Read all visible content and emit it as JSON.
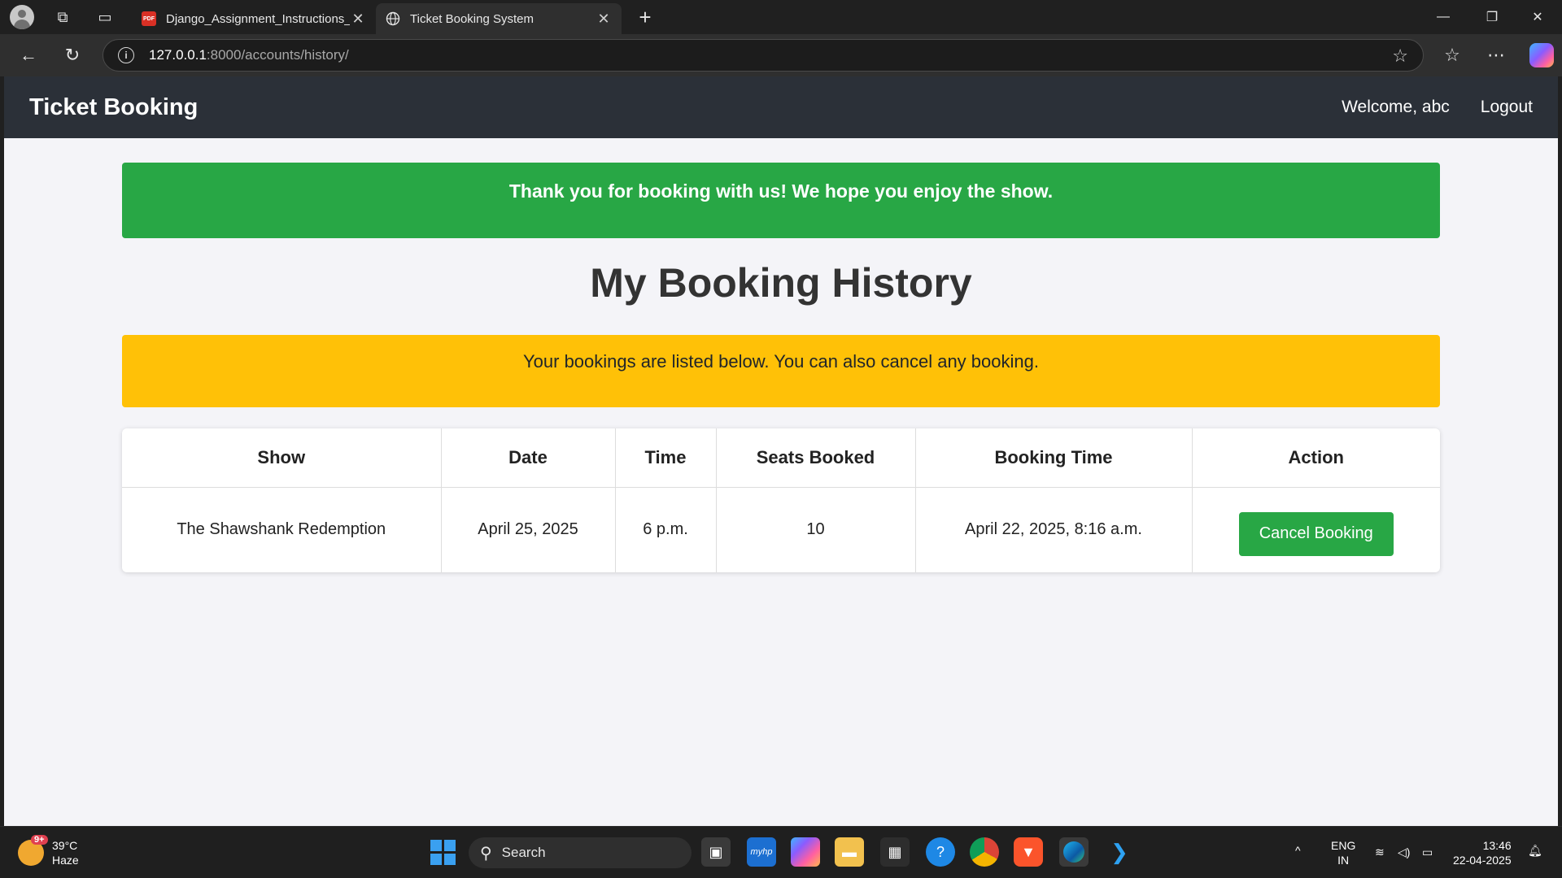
{
  "browser": {
    "tabs": [
      {
        "title": "Django_Assignment_Instructions_",
        "favicon": "pdf-icon",
        "active": false
      },
      {
        "title": "Ticket Booking System",
        "favicon": "globe-icon",
        "active": true
      }
    ],
    "url_host": "127.0.0.1",
    "url_path": ":8000/accounts/history/"
  },
  "site": {
    "brand": "Ticket Booking",
    "welcome": "Welcome, abc",
    "logout": "Logout"
  },
  "messages": {
    "success": "Thank you for booking with us! We hope you enjoy the show.",
    "info": "Your bookings are listed below. You can also cancel any booking."
  },
  "page_title": "My Booking History",
  "table": {
    "headers": [
      "Show",
      "Date",
      "Time",
      "Seats Booked",
      "Booking Time",
      "Action"
    ],
    "rows": [
      {
        "show": "The Shawshank Redemption",
        "date": "April 25, 2025",
        "time": "6 p.m.",
        "seats": "10",
        "booking_time": "April 22, 2025, 8:16 a.m.",
        "action": "Cancel Booking"
      }
    ]
  },
  "taskbar": {
    "weather_temp": "39°C",
    "weather_desc": "Haze",
    "weather_badge": "9+",
    "search_label": "Search",
    "language": "ENG",
    "region": "IN",
    "time": "13:46",
    "date": "22-04-2025"
  },
  "colors": {
    "success": "#28a745",
    "warning": "#ffc107",
    "navbar": "#2b3038",
    "page_bg": "#f4f4f8"
  }
}
